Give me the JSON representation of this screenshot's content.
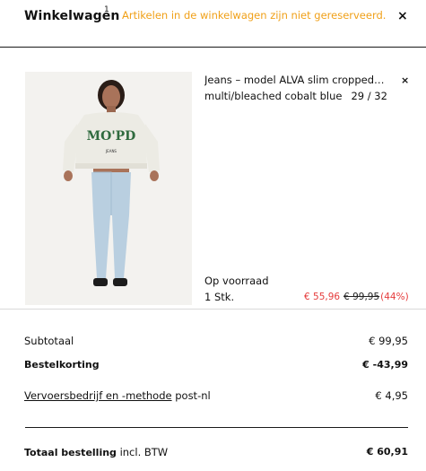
{
  "header": {
    "title": "Winkelwagen",
    "count": "1",
    "notice": "Artikelen in de winkelwagen zijn niet gereserveerd.",
    "close_label": "×"
  },
  "product": {
    "name": "Jeans – model ALVA slim cropped…",
    "color": "multi/bleached cobalt blue",
    "size": "29 / 32",
    "remove_label": "×",
    "stock": "Op voorraad",
    "qty": "1 Stk.",
    "price_sale": "€ 55,96",
    "price_old": "€ 99,95",
    "discount_pct": "(44%)",
    "shirt_print": "MO'PD",
    "shirt_sub": "JEANS"
  },
  "summary": {
    "subtotal_label": "Subtotaal",
    "subtotal_value": "€ 99,95",
    "discount_label": "Bestelkorting",
    "discount_value": "€ -43,99",
    "shipping_link": "Vervoersbedrijf en -methode",
    "shipping_method": " post-nl",
    "shipping_value": "€ 4,95",
    "total_label": "Totaal bestelling",
    "total_suffix": " incl. BTW",
    "total_value": "€ 60,91"
  },
  "colors": {
    "notice": "#f0a018",
    "sale": "#e53b3b"
  }
}
